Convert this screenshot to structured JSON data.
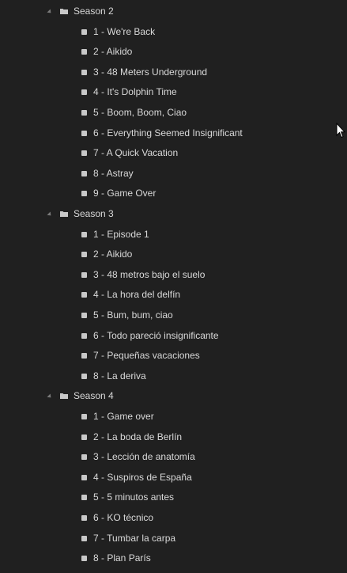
{
  "tree": [
    {
      "season": "Season 2",
      "episodes": [
        "1 - We're Back",
        "2 - Aikido",
        "3 - 48 Meters Underground",
        "4 - It's Dolphin Time",
        "5 - Boom, Boom, Ciao",
        "6 - Everything Seemed Insignificant",
        "7 - A Quick Vacation",
        "8 - Astray",
        "9 - Game Over"
      ]
    },
    {
      "season": "Season 3",
      "episodes": [
        "1 - Episode 1",
        "2 - Aikido",
        "3 - 48 metros bajo el suelo",
        "4 - La hora del delfín",
        "5 - Bum, bum, ciao",
        "6 - Todo pareció insignificante",
        "7 - Pequeñas vacaciones",
        "8 - La deriva"
      ]
    },
    {
      "season": "Season 4",
      "episodes": [
        "1 - Game over",
        "2 - La boda de Berlín",
        "3 - Lección de anatomía",
        "4 - Suspiros de España",
        "5 - 5 minutos antes",
        "6 - KO técnico",
        "7 - Tumbar la carpa",
        "8 - Plan París"
      ]
    }
  ],
  "icons": {
    "expand": "expanded-arrow-icon",
    "folder": "folder-icon",
    "file": "file-icon",
    "cursor": "mouse-cursor-icon"
  },
  "colors": {
    "background": "#202020",
    "text": "#d9d9d9",
    "icon": "#c8c8c8"
  }
}
